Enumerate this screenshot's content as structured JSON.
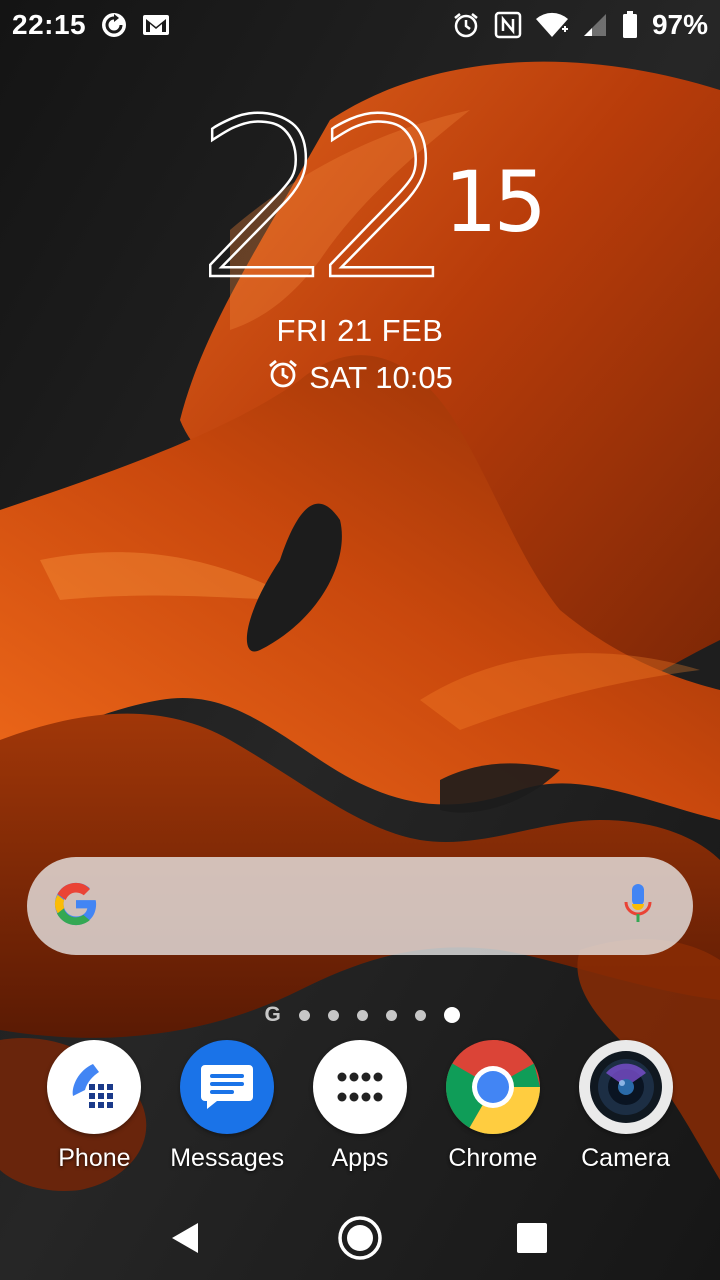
{
  "status_bar": {
    "time": "22:15",
    "battery_percent": "97%",
    "icons": [
      "sync-icon",
      "gmail-icon",
      "alarm-icon",
      "nfc-icon",
      "wifi-icon",
      "signal-icon",
      "battery-icon"
    ]
  },
  "clock": {
    "hour": "22",
    "minute": "15",
    "date": "FRI 21 FEB",
    "next_alarm": "SAT 10:05"
  },
  "search_bar": {
    "icons": [
      "google-g-icon",
      "microphone-icon"
    ]
  },
  "pager": {
    "google_page_label": "G",
    "page_count": 6,
    "active_page": 6
  },
  "dock": {
    "apps": [
      {
        "label": "Phone",
        "icon": "phone-icon"
      },
      {
        "label": "Messages",
        "icon": "messages-icon"
      },
      {
        "label": "Apps",
        "icon": "app-drawer-icon"
      },
      {
        "label": "Chrome",
        "icon": "chrome-icon"
      },
      {
        "label": "Camera",
        "icon": "camera-icon"
      }
    ]
  },
  "nav_bar": {
    "icons": [
      "back-icon",
      "home-icon",
      "recents-icon"
    ]
  },
  "colors": {
    "wallpaper_dark": "#1b1b1b",
    "wallpaper_orange": "#c84a10",
    "messages_blue": "#1a73e8",
    "phone_blue": "#4285f4"
  }
}
